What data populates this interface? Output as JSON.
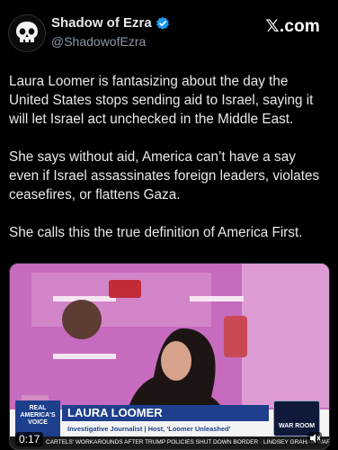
{
  "tweet": {
    "display_name": "Shadow of Ezra",
    "handle": "@ShadowofEzra",
    "brand": "𝕏.com",
    "paragraphs": [
      "Laura Loomer is fantasizing about the day the United States stops sending aid to Israel, saying it will let Israel act unchecked in the Middle East.",
      "She says without aid, America can’t have a say even if Israel assassinates foreign leaders, violates ceasefires, or flattens Gaza.",
      "She calls this the true definition of America First."
    ]
  },
  "video": {
    "timestamp": "0:17",
    "lower_third_name": "LAURA LOOMER",
    "lower_third_title": "Investigative Journalist | Host, 'Loomer Unleashed'",
    "channel_box": "REAL AMERICA'S VOICE",
    "show_logo": "WAR ROOM",
    "ticker": "CARTELS' WORKAROUNDS AFTER TRUMP POLICIES SHUT DOWN BORDER · LINDSEY GRAHAM WARNS NO",
    "icons": {
      "speaker": "speaker-icon",
      "verified": "verified-badge-icon",
      "avatar": "skull-avatar-icon"
    },
    "colors": {
      "bg": "#000000",
      "accent": "#1d9bf0",
      "lower_third_blue": "#1d3f8c"
    }
  }
}
